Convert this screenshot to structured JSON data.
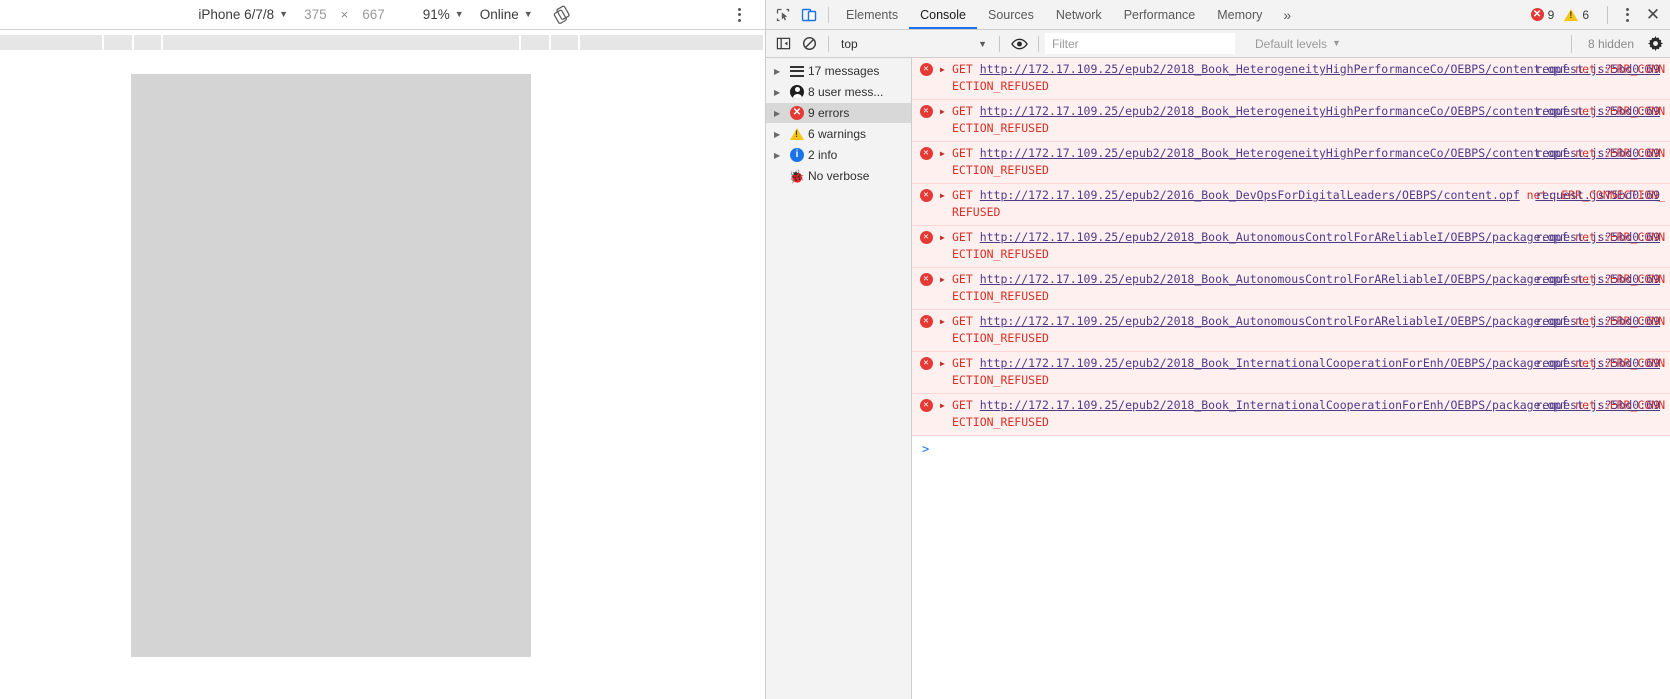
{
  "device_toolbar": {
    "device": "iPhone 6/7/8",
    "width": "375",
    "times": "×",
    "height": "667",
    "zoom": "91%",
    "throttling": "Online",
    "rotate_icon": "rotate-device-icon",
    "more_icon": "more-options-icon"
  },
  "devtools": {
    "inspect_icon": "inspect-element-icon",
    "device_toggle_icon": "toggle-device-toolbar-icon",
    "tabs": [
      {
        "label": "Elements",
        "active": false
      },
      {
        "label": "Console",
        "active": true
      },
      {
        "label": "Sources",
        "active": false
      },
      {
        "label": "Network",
        "active": false
      },
      {
        "label": "Performance",
        "active": false
      },
      {
        "label": "Memory",
        "active": false
      }
    ],
    "more_tabs": "»",
    "error_count": "9",
    "warning_count": "6",
    "kebab_icon": "customize-devtools-icon",
    "close_icon": "close-devtools-icon"
  },
  "console_toolbar": {
    "sidebar_toggle_icon": "console-sidebar-toggle-icon",
    "clear_icon": "clear-console-icon",
    "context": "top",
    "eye_icon": "live-expression-icon",
    "filter_placeholder": "Filter",
    "filter_value": "",
    "levels": "Default levels",
    "hidden": "8 hidden",
    "settings_icon": "console-settings-icon"
  },
  "console_sidebar": {
    "items": [
      {
        "label": "17 messages",
        "icon": "list-icon",
        "selected": false,
        "arrow": true
      },
      {
        "label": "8 user mess...",
        "icon": "user-icon",
        "selected": false,
        "arrow": true
      },
      {
        "label": "9 errors",
        "icon": "error-icon",
        "selected": true,
        "arrow": true
      },
      {
        "label": "6 warnings",
        "icon": "warning-icon",
        "selected": false,
        "arrow": true
      },
      {
        "label": "2 info",
        "icon": "info-icon",
        "selected": false,
        "arrow": true
      },
      {
        "label": "No verbose",
        "icon": "bug-icon",
        "selected": false,
        "arrow": false
      }
    ]
  },
  "console_messages": {
    "method": "GET",
    "error_suffix": "net::ERR_CONNECTION_REFUSED",
    "items": [
      {
        "url": "http://172.17.109.25/epub2/2018_Book_HeterogeneityHighPerformanceCo/OEBPS/content.opf",
        "source": "request.js?5bd0:69"
      },
      {
        "url": "http://172.17.109.25/epub2/2018_Book_HeterogeneityHighPerformanceCo/OEBPS/content.opf",
        "source": "request.js?5bd0:69"
      },
      {
        "url": "http://172.17.109.25/epub2/2018_Book_HeterogeneityHighPerformanceCo/OEBPS/content.opf",
        "source": "request.js?5bd0:69"
      },
      {
        "url": "http://172.17.109.25/epub2/2016_Book_DevOpsForDigitalLeaders/OEBPS/content.opf",
        "source": "request.js?5bd0:69"
      },
      {
        "url": "http://172.17.109.25/epub2/2018_Book_AutonomousControlForAReliableI/OEBPS/package.opf",
        "source": "request.js?5bd0:69"
      },
      {
        "url": "http://172.17.109.25/epub2/2018_Book_AutonomousControlForAReliableI/OEBPS/package.opf",
        "source": "request.js?5bd0:69"
      },
      {
        "url": "http://172.17.109.25/epub2/2018_Book_AutonomousControlForAReliableI/OEBPS/package.opf",
        "source": "request.js?5bd0:69"
      },
      {
        "url": "http://172.17.109.25/epub2/2018_Book_InternationalCooperationForEnh/OEBPS/package.opf",
        "source": "request.js?5bd0:69"
      },
      {
        "url": "http://172.17.109.25/epub2/2018_Book_InternationalCooperationForEnh/OEBPS/package.opf",
        "source": "request.js?5bd0:69"
      }
    ],
    "prompt": ">"
  },
  "colors": {
    "accent": "#1a73e8",
    "error_red": "#d93025",
    "error_bg": "#fff0f0",
    "warning_yellow": "#f5c518",
    "link_purple": "#4f3b8a",
    "toolbar_bg": "#f3f3f3",
    "device_screen": "#d4d4d4"
  }
}
